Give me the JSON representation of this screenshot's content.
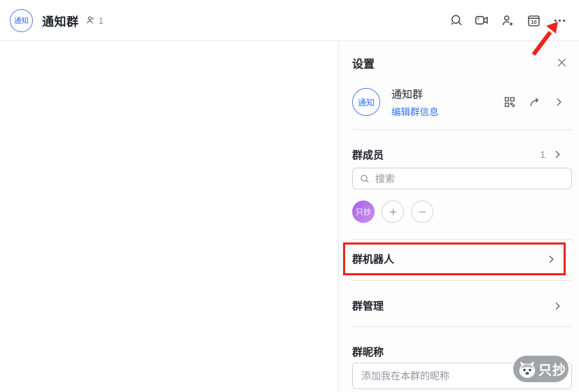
{
  "topbar": {
    "avatar_text": "通知",
    "title": "通知群",
    "member_count": "1",
    "calendar_day": "10",
    "icons": [
      "search-icon",
      "video-call-icon",
      "add-member-icon",
      "calendar-icon",
      "more-icon"
    ]
  },
  "panel": {
    "title": "设置",
    "group_info": {
      "avatar_text": "通知",
      "name": "通知群",
      "edit_link": "编辑群信息"
    },
    "members": {
      "label": "群成员",
      "count": "1",
      "search_placeholder": "搜索",
      "first_member": "只抄"
    },
    "robots_row": {
      "label": "群机器人"
    },
    "management_row": {
      "label": "群管理"
    },
    "nickname": {
      "label": "群昵称",
      "placeholder": "添加我在本群的昵称"
    }
  },
  "watermark": {
    "text": "只抄"
  },
  "colors": {
    "accent_blue": "#3370ff",
    "annotation_red": "#e8281e",
    "member_avatar_gradient_start": "#a763e8",
    "member_avatar_gradient_end": "#c98fee",
    "divider": "#e5e6e8"
  }
}
